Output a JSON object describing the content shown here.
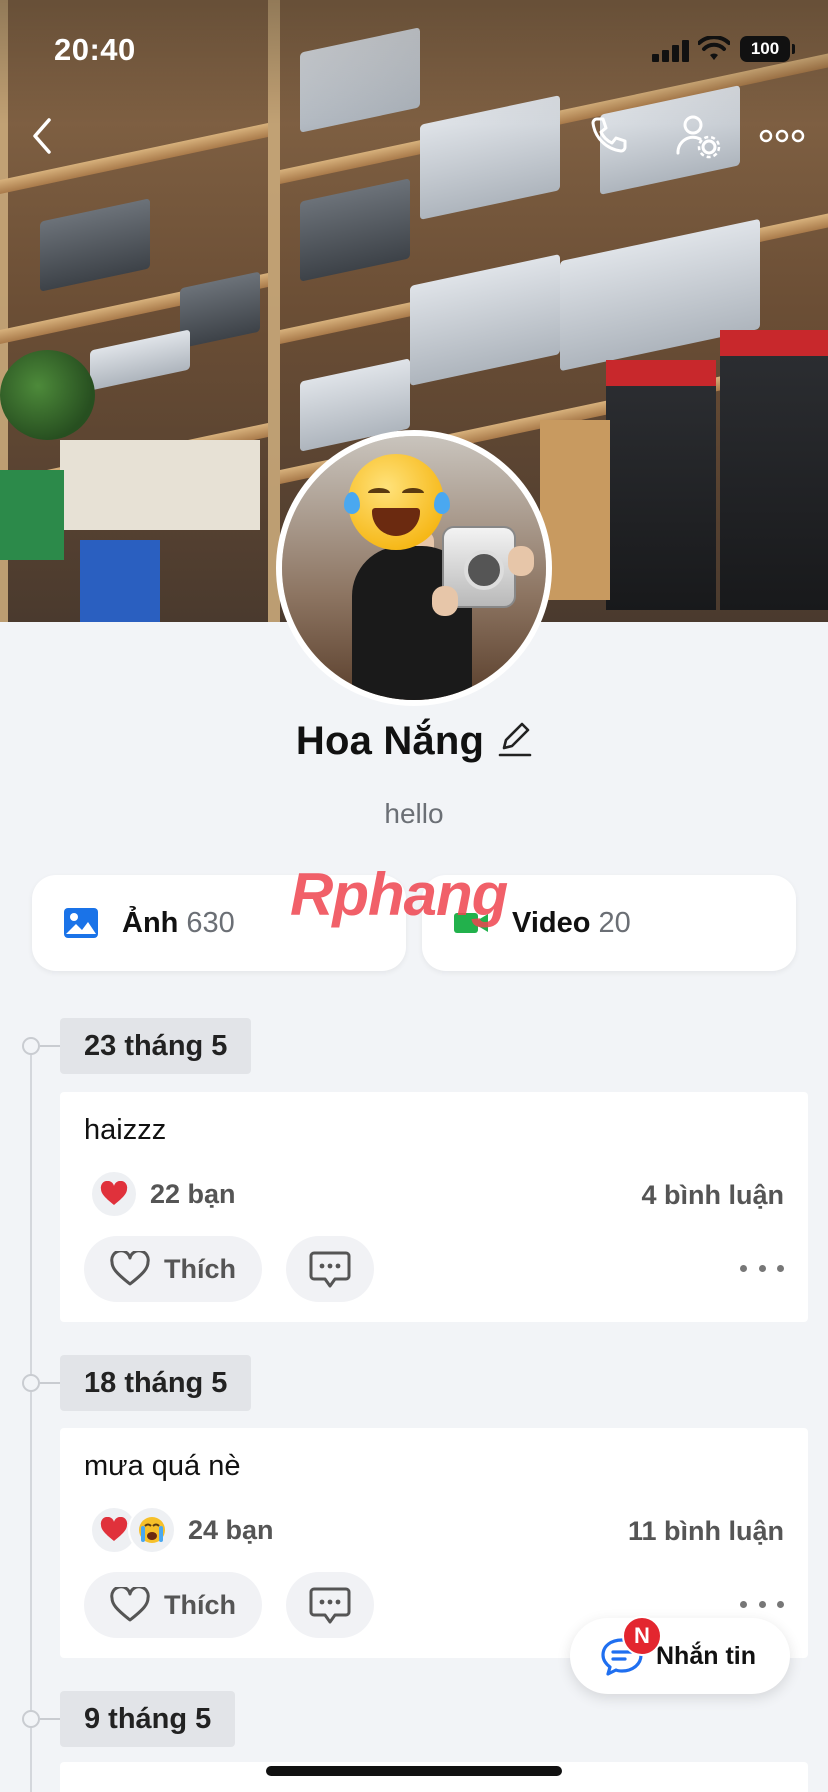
{
  "status_bar": {
    "time": "20:40",
    "battery": "100"
  },
  "profile": {
    "name": "Hoa Nắng",
    "bio": "hello"
  },
  "watermark": {
    "part1": "Rphang",
    "part2": ""
  },
  "media": {
    "photos": {
      "label": "Ảnh",
      "count": "630"
    },
    "videos": {
      "label": "Video",
      "count": "20"
    }
  },
  "timeline": [
    {
      "date": "23 tháng 5",
      "text": "haizzz",
      "reactions_count": "22 bạn",
      "comments": "4 bình luận",
      "like_label": "Thích",
      "reactions": [
        "heart-icon"
      ]
    },
    {
      "date": "18 tháng 5",
      "text": "mưa quá nè",
      "reactions_count": "24 bạn",
      "comments": "11 bình luận",
      "like_label": "Thích",
      "reactions": [
        "heart-icon",
        "crying-face-icon"
      ]
    },
    {
      "date": "9 tháng 5"
    }
  ],
  "message_button": {
    "label": "Nhắn tin",
    "badge": "N"
  },
  "colors": {
    "accent": "#1f6ff0",
    "photo_icon": "#1a73e8",
    "video_icon": "#22b14c",
    "badge": "#e3262f",
    "heart": "#e0313b"
  }
}
